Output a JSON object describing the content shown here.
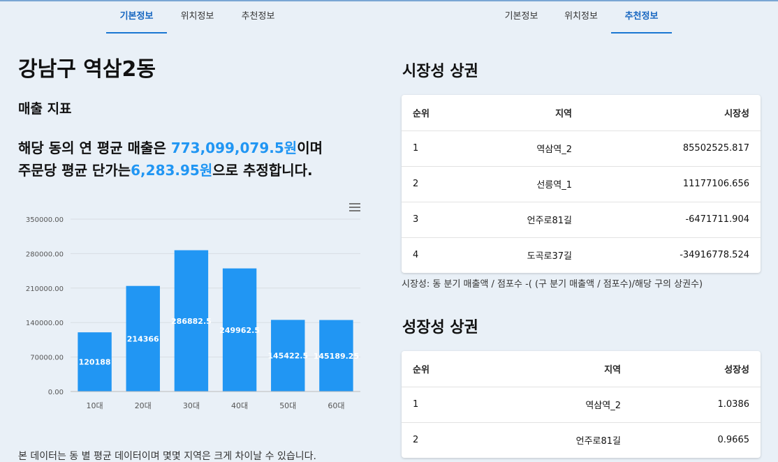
{
  "tabs_left": [
    {
      "label": "기본정보",
      "active": true
    },
    {
      "label": "위치정보",
      "active": false
    },
    {
      "label": "추천정보",
      "active": false
    }
  ],
  "tabs_right": [
    {
      "label": "기본정보",
      "active": false
    },
    {
      "label": "위치정보",
      "active": false
    },
    {
      "label": "추천정보",
      "active": true
    }
  ],
  "left": {
    "dong_title": "강남구 역삼2동",
    "sales_title": "매출 지표",
    "summary": {
      "line1_prefix": "해당 동의 연 평균 매출은 ",
      "annual_sales": "773,099,079.5원",
      "line1_suffix": "이며",
      "line2_prefix": "주문당 평균 단가는",
      "unit_price": "6,283.95원",
      "line2_suffix": "으로 추정합니다."
    },
    "footnote": "본 데이터는 동 별 평균 데이터이며 몇몇 지역은 크게 차이날 수 있습니다."
  },
  "chart_data": {
    "type": "bar",
    "categories": [
      "10대",
      "20대",
      "30대",
      "40대",
      "50대",
      "60대"
    ],
    "values": [
      120188,
      214366,
      286882.5,
      249962.5,
      145422.5,
      145189.25
    ],
    "data_labels": [
      "120188",
      "214366",
      "286882.5",
      "249962.5",
      "145422.5",
      "145189.25"
    ],
    "y_ticks": [
      "0.00",
      "70000.00",
      "140000.00",
      "210000.00",
      "280000.00",
      "350000.00"
    ],
    "ylim": [
      0,
      350000
    ],
    "grid": true,
    "bar_color": "#2196f3"
  },
  "market": {
    "title": "시장성 상권",
    "headers": [
      "순위",
      "지역",
      "시장성"
    ],
    "rows": [
      [
        "1",
        "역삼역_2",
        "85502525.817"
      ],
      [
        "2",
        "선릉역_1",
        "11177106.656"
      ],
      [
        "3",
        "언주로81길",
        "-6471711.904"
      ],
      [
        "4",
        "도곡로37길",
        "-34916778.524"
      ]
    ],
    "formula": "시장성: 동 분기 매출액 / 점포수 -( (구 분기 매출액 / 점포수)/해당 구의 상권수)"
  },
  "growth": {
    "title": "성장성 상권",
    "headers": [
      "순위",
      "지역",
      "성장성"
    ],
    "rows": [
      [
        "1",
        "역삼역_2",
        "1.0386"
      ],
      [
        "2",
        "언주로81길",
        "0.9665"
      ]
    ]
  }
}
